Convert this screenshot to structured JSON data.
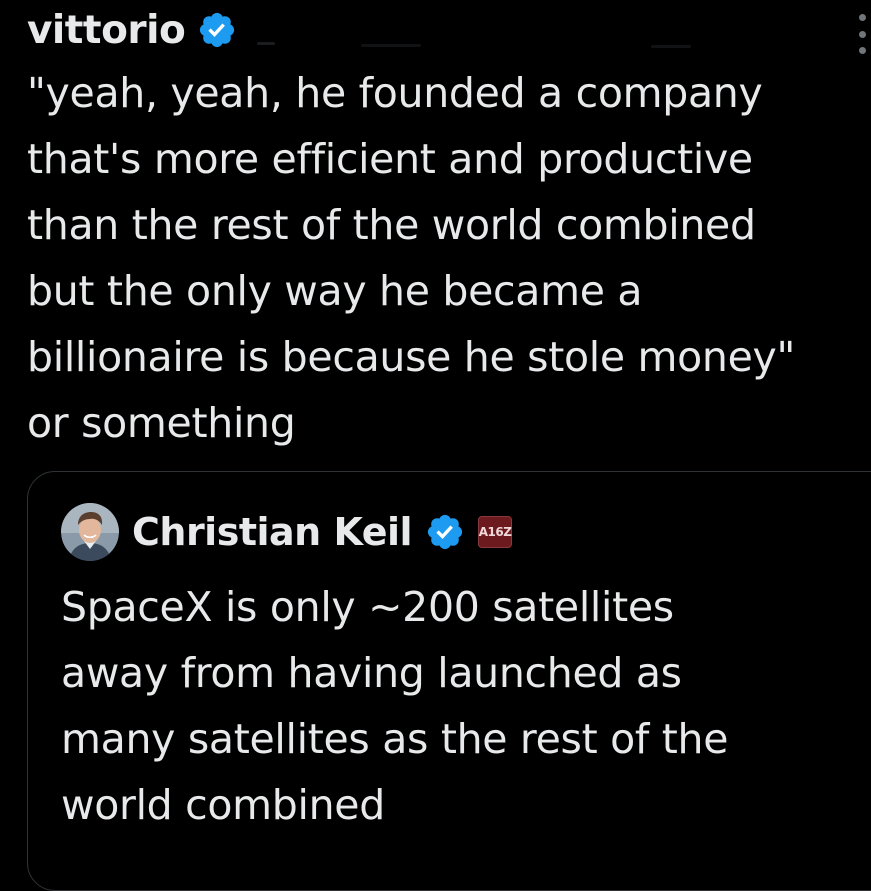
{
  "colors": {
    "background": "#000000",
    "text": "#e7e9ea",
    "verified_badge": "#1d9bf0",
    "card_border": "#2f3336",
    "affiliate_badge": "#6d1a1f"
  },
  "post": {
    "author": {
      "display_name": "vittorio",
      "verified_icon": "verified-badge-icon"
    },
    "more_icon": "more-options-icon",
    "text_lines": [
      "\"yeah, yeah, he founded a company",
      "that's more efficient and productive",
      "than the rest of the world combined",
      "but the only way he became a",
      "billionaire is because he stole money\"",
      "or something"
    ]
  },
  "quoted_post": {
    "author": {
      "display_name": "Christian Keil",
      "avatar_icon": "avatar",
      "verified_icon": "verified-badge-icon",
      "affiliate_badge_text": "A16Z"
    },
    "text_lines": [
      "SpaceX is only ~200 satellites",
      "away from having launched as",
      "many satellites as the rest of the",
      "world combined"
    ]
  }
}
